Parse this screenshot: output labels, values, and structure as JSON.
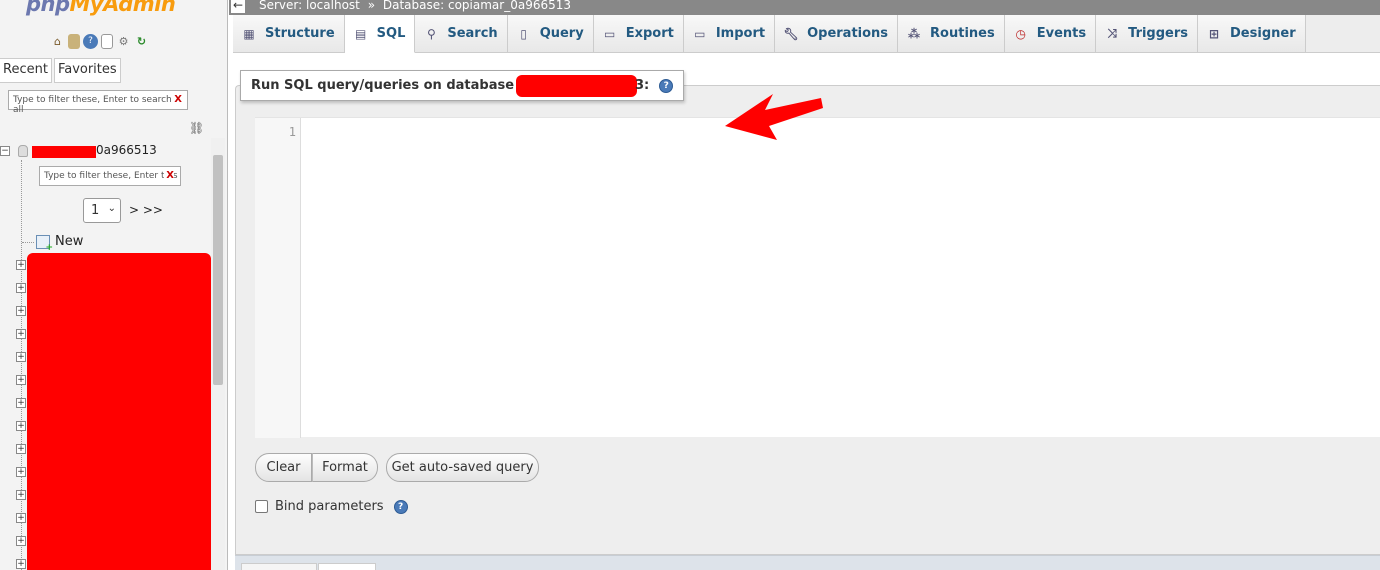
{
  "sidebar": {
    "logo_php": "php",
    "logo_myadmin": "MyAdmin",
    "quick_icons": [
      "home-icon",
      "logout-icon",
      "help-icon",
      "docs-icon",
      "settings-icon",
      "reload-icon"
    ],
    "recent_label": "Recent",
    "favorites_label": "Favorites",
    "filter_placeholder": "Type to filter these, Enter to search all",
    "filter_clear": "X",
    "db_name_visible": "0a966513",
    "table_filter_placeholder": "Type to filter these, Enter to s",
    "table_filter_clear": "X",
    "page_select_value": "1",
    "page_next": "> >>",
    "new_label": "New"
  },
  "breadcrumb": {
    "server": "Server: localhost",
    "separator": "»",
    "database": "Database: copiamar_0a966513"
  },
  "tabs": [
    {
      "label": "Structure",
      "icon": "structure-icon",
      "active": false
    },
    {
      "label": "SQL",
      "icon": "sql-icon",
      "active": true
    },
    {
      "label": "Search",
      "icon": "search-icon",
      "active": false
    },
    {
      "label": "Query",
      "icon": "query-icon",
      "active": false
    },
    {
      "label": "Export",
      "icon": "export-icon",
      "active": false
    },
    {
      "label": "Import",
      "icon": "import-icon",
      "active": false
    },
    {
      "label": "Operations",
      "icon": "wrench-icon",
      "active": false
    },
    {
      "label": "Routines",
      "icon": "routines-icon",
      "active": false
    },
    {
      "label": "Events",
      "icon": "clock-icon",
      "active": false
    },
    {
      "label": "Triggers",
      "icon": "triggers-icon",
      "active": false
    },
    {
      "label": "Designer",
      "icon": "designer-icon",
      "active": false
    }
  ],
  "sql_panel": {
    "legend_prefix": "Run SQL query/queries on database",
    "legend_suffix": "3:",
    "line_number": "1",
    "clear_label": "Clear",
    "format_label": "Format",
    "autosaved_label": "Get auto-saved query",
    "bind_label": "Bind parameters"
  },
  "colors": {
    "accent": "#235a81",
    "redaction": "#ff0000",
    "logo_blue": "#6c78af",
    "logo_orange": "#f89c0e"
  }
}
